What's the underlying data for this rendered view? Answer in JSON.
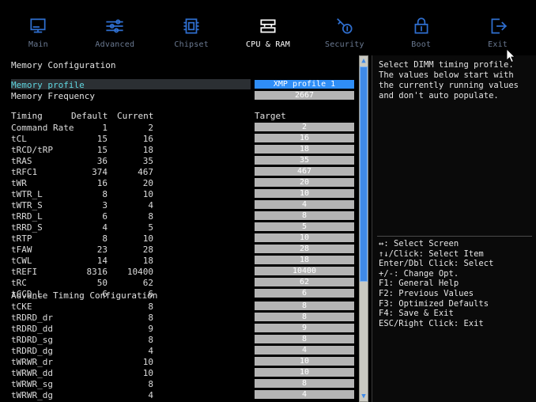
{
  "nav": {
    "items": [
      {
        "label": "Main",
        "icon": "monitor-icon",
        "active": false
      },
      {
        "label": "Advanced",
        "icon": "sliders-icon",
        "active": false
      },
      {
        "label": "Chipset",
        "icon": "chip-icon",
        "active": false
      },
      {
        "label": "CPU & RAM",
        "icon": "ram-icon",
        "active": true
      },
      {
        "label": "Security",
        "icon": "key-icon",
        "active": false
      },
      {
        "label": "Boot",
        "icon": "lock-icon",
        "active": false
      },
      {
        "label": "Exit",
        "icon": "exit-icon",
        "active": false
      }
    ]
  },
  "main": {
    "section_title": "Memory Configuration",
    "settings": [
      {
        "label": "Memory profile",
        "value": "XMP profile 1",
        "selected": true,
        "style": "blue"
      },
      {
        "label": "Memory Frequency",
        "value": "2667",
        "selected": false,
        "style": "gray"
      }
    ],
    "timing_headers": {
      "timing": "Timing",
      "default": "Default",
      "current": "Current",
      "target": "Target"
    },
    "timings": [
      {
        "name": "Command Rate",
        "default": "1",
        "current": "2",
        "target": "2"
      },
      {
        "name": "tCL",
        "default": "15",
        "current": "16",
        "target": "16"
      },
      {
        "name": "tRCD/tRP",
        "default": "15",
        "current": "18",
        "target": "18"
      },
      {
        "name": "tRAS",
        "default": "36",
        "current": "35",
        "target": "35"
      },
      {
        "name": "tRFC1",
        "default": "374",
        "current": "467",
        "target": "467"
      },
      {
        "name": "tWR",
        "default": "16",
        "current": "20",
        "target": "20"
      },
      {
        "name": "tWTR_L",
        "default": "8",
        "current": "10",
        "target": "10"
      },
      {
        "name": "tWTR_S",
        "default": "3",
        "current": "4",
        "target": "4"
      },
      {
        "name": "tRRD_L",
        "default": "6",
        "current": "8",
        "target": "8"
      },
      {
        "name": "tRRD_S",
        "default": "4",
        "current": "5",
        "target": "5"
      },
      {
        "name": "tRTP",
        "default": "8",
        "current": "10",
        "target": "10"
      },
      {
        "name": "tFAW",
        "default": "23",
        "current": "28",
        "target": "28"
      },
      {
        "name": "tCWL",
        "default": "14",
        "current": "18",
        "target": "18"
      },
      {
        "name": "tREFI",
        "default": "8316",
        "current": "10400",
        "target": "10400"
      },
      {
        "name": "tRC",
        "default": "50",
        "current": "62",
        "target": "62"
      },
      {
        "name": "tCCD_L",
        "default": "6",
        "current": "6",
        "target": "6"
      }
    ],
    "advance_title": "Advance Timing Configuration",
    "advance_timings": [
      {
        "name": "tCKE",
        "value": "8",
        "target": "8"
      },
      {
        "name": "tRDRD_dr",
        "value": "8",
        "target": "8"
      },
      {
        "name": "tRDRD_dd",
        "value": "9",
        "target": "9"
      },
      {
        "name": "tRDRD_sg",
        "value": "8",
        "target": "8"
      },
      {
        "name": "tRDRD_dg",
        "value": "4",
        "target": "4"
      },
      {
        "name": "tWRWR_dr",
        "value": "10",
        "target": "10"
      },
      {
        "name": "tWRWR_dd",
        "value": "10",
        "target": "10"
      },
      {
        "name": "tWRWR_sg",
        "value": "8",
        "target": "8"
      },
      {
        "name": "tWRWR_dg",
        "value": "4",
        "target": "4"
      }
    ]
  },
  "help": {
    "text": "Select DIMM timing profile. The values below start with the currently running values and don't auto populate."
  },
  "keys": [
    "↔: Select Screen",
    "↑↓/Click: Select Item",
    "Enter/Dbl Click: Select",
    "+/-: Change Opt.",
    "F1: General Help",
    "F2: Previous Values",
    "F3: Optimized Defaults",
    "F4: Save & Exit",
    "ESC/Right Click: Exit"
  ],
  "colors": {
    "accent_blue": "#2f8ef7",
    "icon_blue": "#2f6fd0",
    "value_gray": "#b4b4b4",
    "selected_label": "#5fd6e0",
    "scrollbar_thumb": "#3f8ae8"
  }
}
